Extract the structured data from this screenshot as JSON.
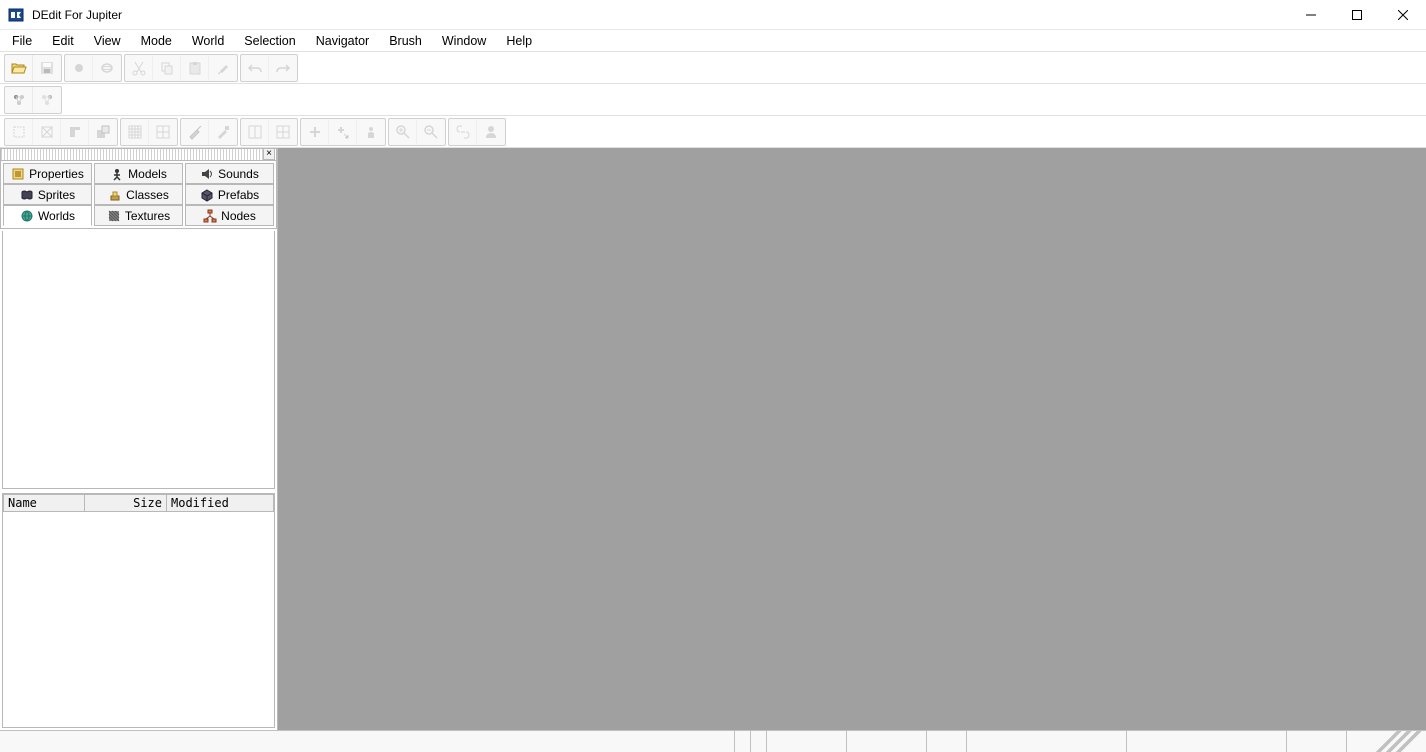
{
  "window": {
    "title": "DEdit For Jupiter"
  },
  "menu": {
    "items": [
      "File",
      "Edit",
      "View",
      "Mode",
      "World",
      "Selection",
      "Navigator",
      "Brush",
      "Window",
      "Help"
    ]
  },
  "toolbar1": {
    "icons": [
      "open",
      "save",
      "sep",
      "world-brush",
      "world-sphere",
      "sep",
      "cut",
      "copy",
      "paste",
      "paint",
      "sep",
      "undo",
      "redo"
    ]
  },
  "toolbar2": {
    "icons": [
      "node-a",
      "node-b"
    ]
  },
  "toolbar3": {
    "groups": [
      [
        "select-box",
        "select-cross",
        "select-push",
        "select-pull"
      ],
      [
        "grid-small",
        "grid-large"
      ],
      [
        "wrench-a",
        "wrench-b"
      ],
      [
        "split-v",
        "split-4"
      ],
      [
        "plus",
        "plus-arrow",
        "entity"
      ],
      [
        "zoom-in",
        "zoom-out"
      ],
      [
        "link",
        "user"
      ]
    ]
  },
  "sidebar": {
    "tabs": [
      {
        "label": "Properties",
        "icon": "properties"
      },
      {
        "label": "Models",
        "icon": "models"
      },
      {
        "label": "Sounds",
        "icon": "sounds"
      },
      {
        "label": "Sprites",
        "icon": "sprites"
      },
      {
        "label": "Classes",
        "icon": "classes"
      },
      {
        "label": "Prefabs",
        "icon": "prefabs"
      },
      {
        "label": "Worlds",
        "icon": "worlds"
      },
      {
        "label": "Textures",
        "icon": "textures"
      },
      {
        "label": "Nodes",
        "icon": "nodes"
      }
    ],
    "columns": {
      "name": "Name",
      "size": "Size",
      "modified": "Modified"
    }
  }
}
